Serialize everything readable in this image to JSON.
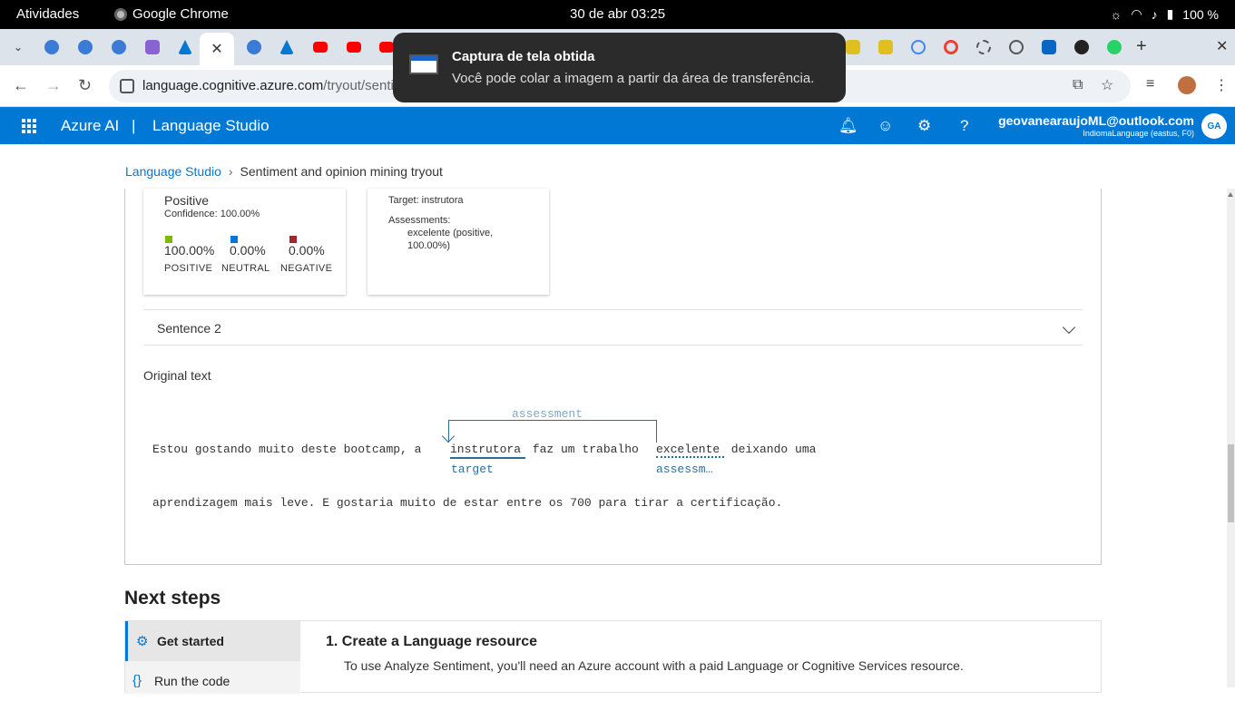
{
  "system_bar": {
    "activities": "Atividades",
    "app_name": "Google Chrome",
    "datetime": "30 de abr  03:25",
    "battery": "100 %"
  },
  "browser": {
    "url_host": "language.cognitive.azure.com",
    "url_path": "/tryout/sentime",
    "active_tab_close": "✕",
    "new_tab": "+",
    "close_window": "✕"
  },
  "notification": {
    "title": "Captura de tela obtida",
    "body": "Você pode colar a imagem a partir da área de transferência."
  },
  "azure_header": {
    "brand": "Azure AI",
    "separator": "|",
    "product": "Language Studio",
    "email": "geovanearaujoML@outlook.com",
    "tenant": "IndiomaLanguage (eastus, F0)",
    "avatar_initials": "GA"
  },
  "breadcrumb": {
    "root": "Language Studio",
    "current": "Sentiment and opinion mining tryout"
  },
  "sentiment_card": {
    "label": "Positive",
    "confidence": "Confidence: 100.00%",
    "scores": [
      {
        "value": "100.00%",
        "caption": "POSITIVE",
        "color": "#7fba00"
      },
      {
        "value": "0.00%",
        "caption": "NEUTRAL",
        "color": "#0078d4"
      },
      {
        "value": "0.00%",
        "caption": "NEGATIVE",
        "color": "#a4262c"
      }
    ]
  },
  "opinion_card": {
    "target": "Target: instrutora",
    "assessments_label": "Assessments:",
    "assessment_line1": "excelente (positive,",
    "assessment_line2": "100.00%)"
  },
  "sentence2": {
    "label": "Sentence 2"
  },
  "original_text": {
    "heading": "Original text",
    "pre_target": "Estou gostando muito deste bootcamp, a ",
    "target_word": "instrutora",
    "mid": " faz um trabalho ",
    "assessment_word": "excelente",
    "post": " deixando uma",
    "line2": "aprendizagem mais leve. E gostaria muito de estar entre os 700 para tirar a certificação.",
    "relation_label": "assessment",
    "target_tag": "target",
    "assessment_tag": "assessm…"
  },
  "next_steps": {
    "heading": "Next steps",
    "nav": [
      {
        "label": "Get started",
        "icon": "gear-icon"
      },
      {
        "label": "Run the code",
        "icon": "braces-icon"
      }
    ],
    "step_title": "1. Create a Language resource",
    "step_text": "To use Analyze Sentiment, you'll need an Azure account with a paid Language or Cognitive Services resource."
  }
}
